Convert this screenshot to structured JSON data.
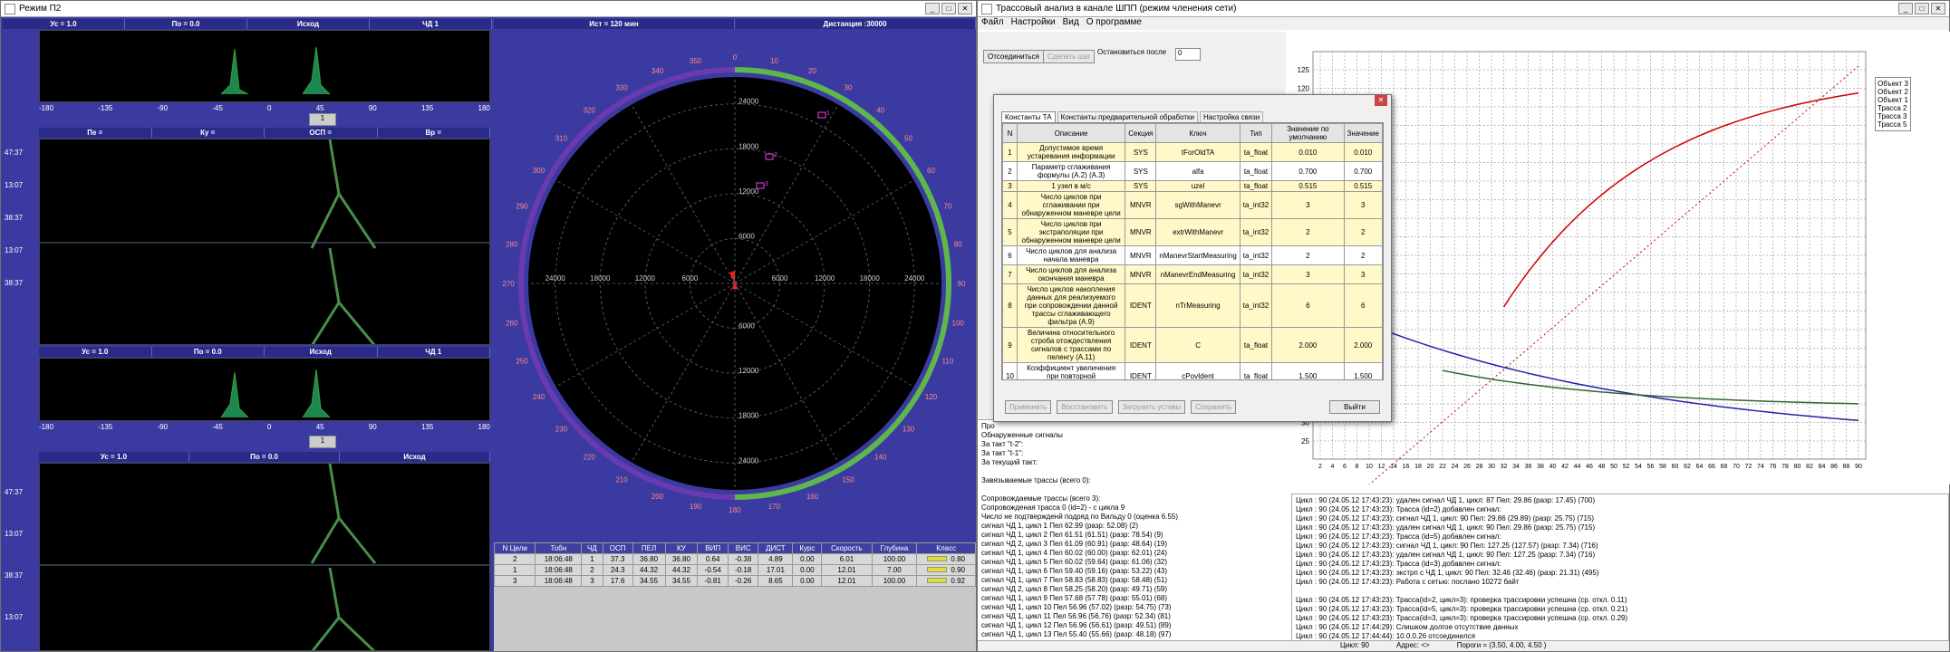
{
  "left": {
    "title": "Режим П2",
    "row1": [
      "Ус = 1.0",
      "По = 0.0",
      "Исход",
      "ЧД 1"
    ],
    "row2": [
      "Пе =",
      "Ку =",
      "ОСП =",
      "Вр ="
    ],
    "row3": [
      "Ус = 1.0",
      "По = 0.0",
      "Исход",
      "ЧД 1"
    ],
    "row4": [
      "Ус = 1.0",
      "По = 0.0",
      "Исход"
    ],
    "xticks": [
      "-180",
      "-135",
      "-90",
      "-45",
      "0",
      "45",
      "90",
      "135",
      "180"
    ],
    "ytimes": [
      "47:37",
      "13:07",
      "38:37",
      "13:07",
      "38:37"
    ],
    "ytimes2": [
      "47:37",
      "13:07",
      "38:37",
      "13:07"
    ],
    "sel1": "1",
    "sel2": "1",
    "radar_header": {
      "left": "Ист = 120 мин",
      "right": "Дистанция :30000"
    },
    "bearings": [
      "0",
      "10",
      "20",
      "30",
      "40",
      "50",
      "60",
      "70",
      "80",
      "90",
      "100",
      "110",
      "120",
      "130",
      "140",
      "150",
      "160",
      "170",
      "180",
      "190",
      "200",
      "210",
      "220",
      "230",
      "240",
      "250",
      "260",
      "270",
      "280",
      "290",
      "300",
      "310",
      "320",
      "330",
      "340",
      "350"
    ],
    "ranges": [
      "24000",
      "18000",
      "12000",
      "6000"
    ],
    "targets": [
      "1",
      "2",
      "3"
    ],
    "table": {
      "headers": [
        "N Цели",
        "Тобн",
        "ЧД",
        "ОСП",
        "ПЕЛ",
        "КУ",
        "ВИП",
        "ВИС",
        "ДИСТ",
        "Курс",
        "Скорость",
        "Глубина",
        "Класс"
      ],
      "rows": [
        [
          "2",
          "18:06:48",
          "1",
          "37.3",
          "36.80",
          "36.80",
          "0.64",
          "-0.38",
          "4.89",
          "0.00",
          "6.01",
          "100.00",
          "0.80"
        ],
        [
          "1",
          "18:06:48",
          "2",
          "24.3",
          "44.32",
          "44.32",
          "-0.54",
          "-0.18",
          "17.01",
          "0.00",
          "12.01",
          "7.00",
          "0.90"
        ],
        [
          "3",
          "18:06:48",
          "3",
          "17.6",
          "34.55",
          "34.55",
          "-0.81",
          "-0.26",
          "8.65",
          "0.00",
          "12.01",
          "100.00",
          "0.92"
        ]
      ]
    }
  },
  "right": {
    "title": "Трассовый анализ в канале ШПП (режим членения сети)",
    "menu": [
      "Файл",
      "Настройки",
      "Вид",
      "О программе"
    ],
    "btn_disconnect": "Отсоединиться",
    "btn_step": "Сделать шаг",
    "stop_label": "Остановиться после",
    "stop_value": "0",
    "legend": [
      "Объект 3",
      "Объект 2",
      "Объект 1",
      "Трасса 2",
      "Трасса 3",
      "Трасса 5"
    ],
    "yticks": [
      "125",
      "120",
      "115",
      "110",
      "105",
      "100",
      "95",
      "90",
      "85",
      "80",
      "75",
      "70",
      "65",
      "60",
      "55",
      "50",
      "45",
      "40",
      "35",
      "30",
      "25"
    ],
    "xticks": [
      "2",
      "4",
      "6",
      "8",
      "10",
      "12",
      "14",
      "16",
      "18",
      "20",
      "22",
      "24",
      "26",
      "28",
      "30",
      "32",
      "34",
      "36",
      "38",
      "40",
      "42",
      "44",
      "46",
      "48",
      "50",
      "52",
      "54",
      "56",
      "58",
      "60",
      "62",
      "64",
      "66",
      "68",
      "70",
      "72",
      "74",
      "76",
      "78",
      "80",
      "82",
      "84",
      "86",
      "88",
      "90"
    ],
    "lower_log": [
      "Про",
      "Обнаруженные сигналы",
      "За такт \"t-2\":",
      "За такт \"t-1\":",
      "За текущий такт:",
      "",
      "Завязываемые трассы (всего 0):",
      "",
      "Сопровождаемые трассы (всего 3):",
      "  Сопровожденая трасса 0 (id=2) - с цикла 9",
      "    Число не подтвержденй подряд по Вильду 0 (оценка 6.55)",
      "    сигнал ЧД 1, цикл 1 Пел 62.99 (разр: 52.08) (2)",
      "    сигнал ЧД 1, цикл 2 Пел 61.51 (61.51) (разр: 78.54) (9)",
      "    сигнал ЧД 2, цикл 3 Пел 61.09 (60.91) (разр: 48.64) (19)",
      "    сигнал ЧД 1, цикл 4 Пел 60.02 (60.00) (разр: 62.01) (24)",
      "    сигнал ЧД 1, цикл 5 Пел 60.02 (59.64) (разр: 61.06) (32)",
      "    сигнал ЧД 1, цикл 6 Пел 59.40 (59.16) (разр: 53.22) (43)",
      "    сигнал ЧД 1, цикл 7 Пел 58.83 (58.83) (разр: 58.48) (51)",
      "    сигнал ЧД 2, цикл 8 Пел 58.25 (58.20) (разр: 49.71) (59)",
      "    сигнал ЧД 1, цикл 9 Пел 57.68 (57.78) (разр: 55.01) (68)",
      "    сигнал ЧД 1, цикл 10 Пел 56.96 (57.02) (разр: 54.75) (73)",
      "    сигнал ЧД 1, цикл 11 Пел 56.96 (56.76) (разр: 52.34) (81)",
      "    сигнал ЧД 1, цикл 12 Пел 56.96 (56.61) (разр: 49.51) (89)",
      "    сигнал ЧД 1, цикл 13 Пел 55.40 (55.66) (разр: 48.18) (97)"
    ],
    "right_log": [
      "Цикл : 90 (24.05.12 17:43:23): удален сигнал ЧД 1, цикл: 87 Пел: 29.86 (разр: 17.45) (700)",
      "Цикл : 90 (24.05.12 17:43:23): Трасса (id=2) добавлен сигнал:",
      "Цикл : 90 (24.05.12 17:43:23):     сигнал ЧД 1, цикл: 90 Пел: 29.86 (29.89) (разр: 25.75) (715)",
      "Цикл : 90 (24.05.12 17:43:23): удален сигнал ЧД 1, цикл: 90 Пел: 29.86 (разр: 25.75) (715)",
      "Цикл : 90 (24.05.12 17:43:23): Трасса (id=5) добавлен сигнал:",
      "Цикл : 90 (24.05.12 17:43:23):     сигнал ЧД 1, цикл: 90 Пел: 127.25 (127.57) (разр: 7.34) (716)",
      "Цикл : 90 (24.05.12 17:43:23): удален сигнал ЧД 1, цикл: 90 Пел: 127.25 (разр: 7.34) (716)",
      "Цикл : 90 (24.05.12 17:43:23): Трасса (id=3) добавлен сигнал:",
      "Цикл : 90 (24.05.12 17:43:23):     экстрп с ЧД 1, цикл: 90 Пел: 32.46 (32.46) (разр: 21.31) (495)",
      "Цикл : 90 (24.05.12 17:43:23): Работа с сетью: послано 10272 байт",
      "",
      "Цикл : 90 (24.05.12 17:43:23): Трасса(id=2, цикл=3): проверка трассировки успешна (ср. откл. 0.11)",
      "Цикл : 90 (24.05.12 17:43:23): Трасса(id=5, цикл=3): проверка трассировки успешна (ср. откл. 0.21)",
      "Цикл : 90 (24.05.12 17:43:23): Трасса(id=3, цикл=3): проверка трассировки успешна (ср. откл. 0.29)",
      "Цикл : 90 (24.05.12 17:44:29): Слишком долгое отсутствие данных",
      "Цикл : 90 (24.05.12 17:44:44): 10.0.0.26 отсоединился"
    ],
    "status": [
      "Цикл: 90",
      "Адрес: <>",
      "Пороги = (3.50, 4.00, 4.50 )"
    ]
  },
  "dialog": {
    "tabs": [
      "Константы ТА",
      "Константы предварительной обработки",
      "Настройка связи"
    ],
    "headers": [
      "N",
      "Описание",
      "Секция",
      "Ключ",
      "Тип",
      "Значение по умолчанию",
      "Значение"
    ],
    "rows": [
      [
        "1",
        "Допустимое время устаревания информации",
        "SYS",
        "tForOldTA",
        "ta_float",
        "0.010",
        "0.010"
      ],
      [
        "2",
        "Параметр сглаживания формулы (A.2) (A.3)",
        "SYS",
        "alfa",
        "ta_float",
        "0.700",
        "0.700"
      ],
      [
        "3",
        "1 узел в м/с",
        "SYS",
        "uzel",
        "ta_float",
        "0.515",
        "0.515"
      ],
      [
        "4",
        "Число циклов при сглаживании при обнаруженном маневре цели",
        "MNVR",
        "sgWithManevr",
        "ta_int32",
        "3",
        "3"
      ],
      [
        "5",
        "Число циклов при экстраполяции при обнаруженном маневре цели",
        "MNVR",
        "extrWithManevr",
        "ta_int32",
        "2",
        "2"
      ],
      [
        "6",
        "Число циклов для анализа начала маневра",
        "MNVR",
        "nManevrStartMeasuring",
        "ta_int32",
        "2",
        "2"
      ],
      [
        "7",
        "Число циклов для анализа окончания маневра",
        "MNVR",
        "nManevrEndMeasuring",
        "ta_int32",
        "3",
        "3"
      ],
      [
        "8",
        "Число циклов накопления данных для реализуемого при сопровождении данной трассы сглаживающего фильтра (A.9)",
        "IDENT",
        "nTrMeasuring",
        "ta_int32",
        "6",
        "6"
      ],
      [
        "9",
        "Величина относительного строба отождествления сигналов с трассами по пеленгу (A.11)",
        "IDENT",
        "C",
        "ta_float",
        "2.000",
        "2.000"
      ],
      [
        "10",
        "Коэффициент увеличения при повторной идентификации трассы и",
        "IDENT",
        "cPovIdent",
        "ta_float",
        "1.500",
        "1.500"
      ]
    ],
    "buttons": [
      "Применить",
      "Восстановить",
      "Загрузить уставы",
      "Сохранить"
    ],
    "exit": "Выйти"
  }
}
